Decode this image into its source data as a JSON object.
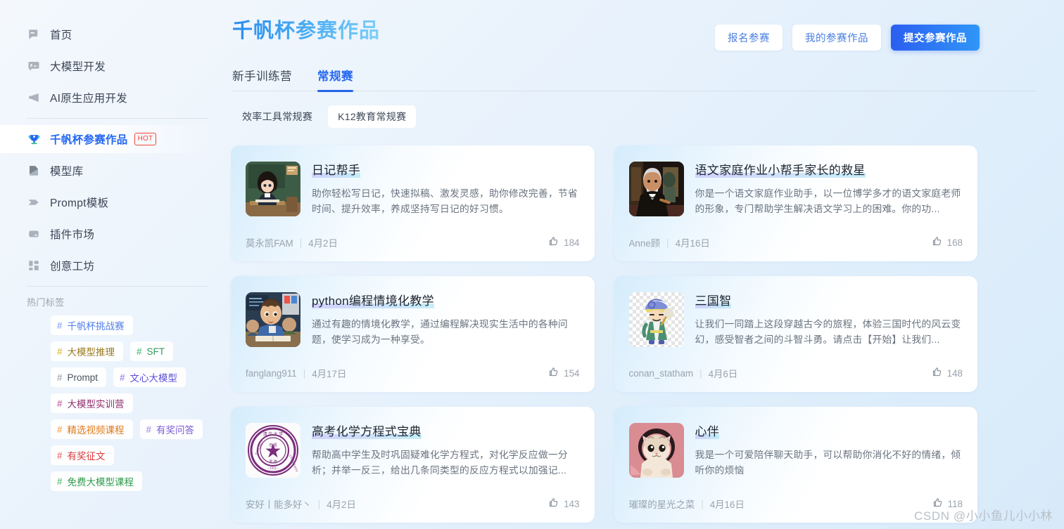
{
  "sidebar": {
    "nav": [
      {
        "label": "首页",
        "icon": "home-flag-icon",
        "active": false
      },
      {
        "label": "大模型开发",
        "icon": "terminal-chat-icon",
        "active": false
      },
      {
        "label": "AI原生应用开发",
        "icon": "megaphone-icon",
        "active": false
      },
      {
        "label": "千帆杯参赛作品",
        "icon": "trophy-icon",
        "active": true,
        "badge": "HOT"
      },
      {
        "label": "模型库",
        "icon": "model-library-icon",
        "active": false
      },
      {
        "label": "Prompt模板",
        "icon": "prompt-template-icon",
        "active": false
      },
      {
        "label": "插件市场",
        "icon": "plugin-market-icon",
        "active": false
      },
      {
        "label": "创意工坊",
        "icon": "creative-workshop-icon",
        "active": false
      }
    ],
    "tags_title": "热门标签",
    "tags": [
      {
        "label": "千帆杯挑战赛",
        "color": "#4f7ee8",
        "hash": "#7ea6f0"
      },
      {
        "label": "大模型推理",
        "color": "#9a7a1e",
        "hash": "#e0b33a"
      },
      {
        "label": "SFT",
        "color": "#2e9a5c",
        "hash": "#49b877"
      },
      {
        "label": "Prompt",
        "color": "#4a5260",
        "hash": "#9aa3ae"
      },
      {
        "label": "文心大模型",
        "color": "#5b4fd6",
        "hash": "#8a82ea"
      },
      {
        "label": "大模型实训营",
        "color": "#8e2e6e",
        "hash": "#c45ba0"
      },
      {
        "label": "精选视频课程",
        "color": "#e07a18",
        "hash": "#f0a04a"
      },
      {
        "label": "有奖问答",
        "color": "#7a5bd6",
        "hash": "#a48ce8"
      },
      {
        "label": "有奖征文",
        "color": "#d83b3b",
        "hash": "#e86a6a"
      },
      {
        "label": "免费大模型课程",
        "color": "#2e9a4a",
        "hash": "#56bd6e"
      }
    ]
  },
  "header": {
    "title": "千帆杯参赛作品",
    "actions": [
      {
        "label": "报名参赛",
        "variant": "ghost"
      },
      {
        "label": "我的参赛作品",
        "variant": "ghost"
      },
      {
        "label": "提交参赛作品",
        "variant": "primary"
      }
    ]
  },
  "tabs": [
    {
      "label": "新手训练营",
      "active": false
    },
    {
      "label": "常规赛",
      "active": true
    }
  ],
  "subtabs": [
    {
      "label": "效率工具常规赛",
      "active": false
    },
    {
      "label": "K12教育常规赛",
      "active": true
    }
  ],
  "cards": [
    {
      "title": "日记帮手",
      "desc": "助你轻松写日记，快速拟稿、激发灵感，助你修改完善，节省时间、提升效率，养成坚持写日记的好习惯。",
      "author": "莫永凯FAM",
      "date": "4月2日",
      "likes": "184",
      "avatar": "schoolgirl-at-desk"
    },
    {
      "title": "语文家庭作业小帮手家长的救星",
      "desc": "你是一个语文家庭作业助手，以一位博学多才的语文家庭老师的形象，专门帮助学生解决语文学习上的困难。你的功...",
      "author": "Anne顾",
      "date": "4月16日",
      "likes": "168",
      "avatar": "elderly-teacher-portrait"
    },
    {
      "title": "python编程情境化教学",
      "desc": "通过有趣的情境化教学，通过编程解决现实生活中的各种问题，使学习成为一种享受。",
      "author": "fanglang911",
      "date": "4月17日",
      "likes": "154",
      "avatar": "boy-in-classroom"
    },
    {
      "title": "三国智",
      "desc": "让我们一同踏上这段穿越古今的旅程，体验三国时代的风云变幻，感受智者之间的斗智斗勇。请点击【开始】让我们...",
      "author": "conan_statham",
      "date": "4月6日",
      "likes": "148",
      "avatar": "ancient-strategist-chibi"
    },
    {
      "title": "高考化学方程式宝典",
      "desc": "帮助高中学生及时巩固疑难化学方程式，对化学反应做一分析；并举一反三，给出几条同类型的反应方程式以加强记...",
      "author": "安好丨能多好丶",
      "date": "4月2日",
      "likes": "143",
      "avatar": "university-emblem"
    },
    {
      "title": "心伴",
      "desc": "我是一个可爱陪伴聊天助手，可以帮助你消化不好的情绪，倾听你的烦恼",
      "author": "璀璨的星光之菜",
      "date": "4月16日",
      "likes": "118",
      "avatar": "kitten-avatar"
    }
  ],
  "watermark": "CSDN @小小鱼儿小小林",
  "colors": {
    "accent": "#2468f2",
    "title_gradient_start": "#2b8cf0",
    "title_gradient_end": "#7fd0f7",
    "hot_badge": "#f5453a",
    "background": "#e8f2fb"
  }
}
